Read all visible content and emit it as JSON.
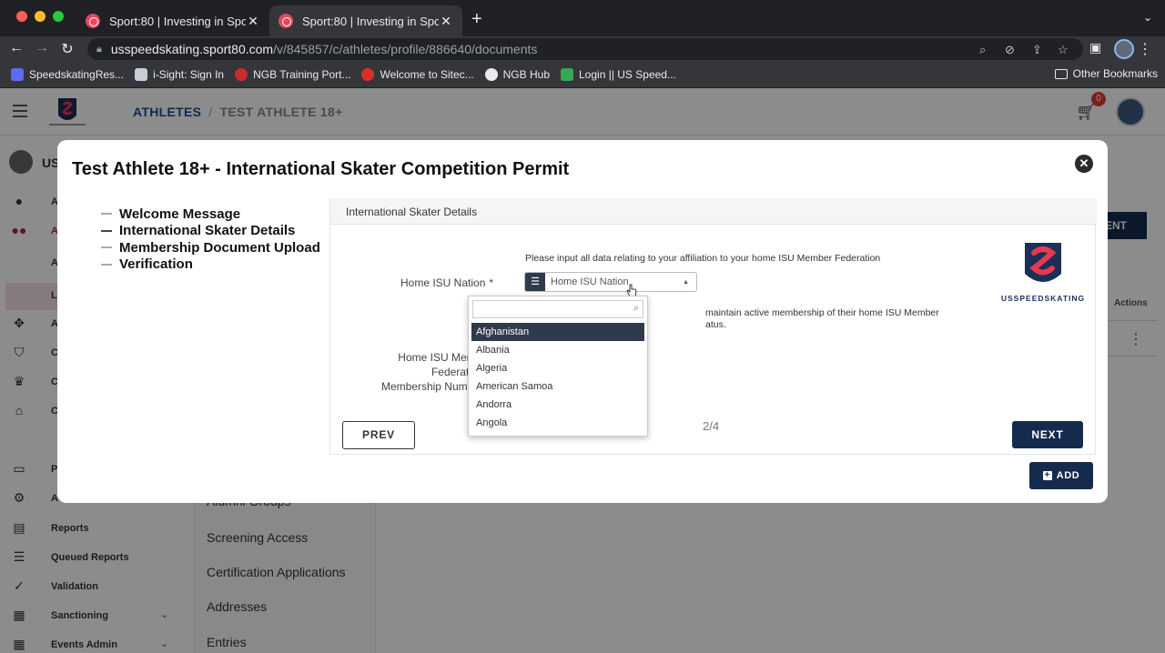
{
  "browser": {
    "tabs": [
      {
        "title": "Sport:80 | Investing in Sport",
        "active": false
      },
      {
        "title": "Sport:80 | Investing in Sport",
        "active": true
      }
    ],
    "url_host": "usspeedskating.sport80.com",
    "url_path": "/v/845857/c/athletes/profile/886640/documents",
    "bookmarks": [
      {
        "label": "SpeedskatingRes...",
        "color": "#5b6cf0"
      },
      {
        "label": "i-Sight: Sign In",
        "color": "#c9ced6"
      },
      {
        "label": "NGB Training Port...",
        "color": "#cc2b2b"
      },
      {
        "label": "Welcome to Sitec...",
        "color": "#d93025"
      },
      {
        "label": "NGB Hub",
        "color": "#e8eaed"
      },
      {
        "label": "Login || US Speed...",
        "color": "#34a853"
      }
    ],
    "other_bookmarks": "Other Bookmarks"
  },
  "app": {
    "breadcrumb": {
      "first": "ATHLETES",
      "separator": "/",
      "second": "TEST ATHLETE 18+"
    },
    "cart_count": "0",
    "user_prefix": "US",
    "sidebar_items": [
      {
        "label": "A",
        "icon": "person-icon"
      },
      {
        "label": "A",
        "icon": "people-icon"
      },
      {
        "label": "A",
        "icon": ""
      },
      {
        "label": "L",
        "icon": ""
      },
      {
        "label": "A",
        "icon": "puzzle-icon"
      },
      {
        "label": "C",
        "icon": "badge-icon"
      },
      {
        "label": "C",
        "icon": "trophy-icon"
      },
      {
        "label": "C",
        "icon": "school-icon"
      },
      {
        "label": "P",
        "icon": "truck-icon"
      },
      {
        "label": "A",
        "icon": "gears-icon"
      },
      {
        "label": "Reports",
        "icon": "report-icon"
      },
      {
        "label": "Queued Reports",
        "icon": "list-icon"
      },
      {
        "label": "Validation",
        "icon": "check-icon"
      },
      {
        "label": "Sanctioning",
        "icon": "calendar-icon"
      },
      {
        "label": "Events Admin",
        "icon": "calendar-icon"
      }
    ],
    "sub_items": [
      "Alumni Groups",
      "Screening Access",
      "Certification Applications",
      "Addresses",
      "Entries"
    ],
    "bg_button": "MENT",
    "bg_actions_header": "Actions"
  },
  "modal": {
    "title": "Test Athlete 18+ - International Skater Competition Permit",
    "steps": [
      "Welcome Message",
      "International Skater Details",
      "Membership Document Upload",
      "Verification"
    ],
    "section_title": "International Skater Details",
    "intro": "Please input all data relating to your affiliation to your home ISU Member Federation",
    "home_nation_label": "Home ISU Nation",
    "required_mark": "*",
    "select_placeholder": "Home ISU Nation",
    "note_line1": "maintain active membership of their home ISU Member",
    "note_line2": "atus.",
    "membership_label_1": "Home ISU Member Federation",
    "membership_label_2": "Membership Number",
    "logo_text": "USSPEEDSKATING",
    "dropdown_options": [
      "Afghanistan",
      "Albania",
      "Algeria",
      "American Samoa",
      "Andorra",
      "Angola"
    ],
    "selected_option": "Afghanistan",
    "page_indicator": "2/4",
    "prev_label": "PREV",
    "next_label": "NEXT",
    "add_label": "ADD"
  }
}
